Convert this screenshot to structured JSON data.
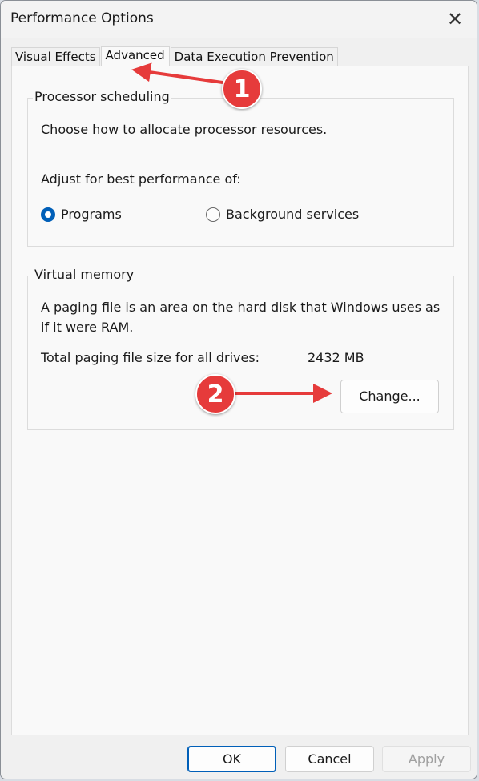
{
  "window": {
    "title": "Performance Options",
    "close_glyph": "✕"
  },
  "tabs": [
    {
      "label": "Visual Effects",
      "active": false
    },
    {
      "label": "Advanced",
      "active": true
    },
    {
      "label": "Data Execution Prevention",
      "active": false
    }
  ],
  "processor_scheduling": {
    "title": "Processor scheduling",
    "description": "Choose how to allocate processor resources.",
    "adjust_label": "Adjust for best performance of:",
    "options": [
      {
        "label": "Programs",
        "selected": true
      },
      {
        "label": "Background services",
        "selected": false
      }
    ]
  },
  "virtual_memory": {
    "title": "Virtual memory",
    "description_line1": "A paging file is an area on the hard disk that Windows uses as",
    "description_line2": "if it were RAM.",
    "total_label": "Total paging file size for all drives:",
    "total_value": "2432 MB",
    "change_button": "Change..."
  },
  "footer": {
    "ok": "OK",
    "cancel": "Cancel",
    "apply": "Apply"
  },
  "annotations": {
    "step1": "1",
    "step2": "2",
    "color": "#e63b3b"
  },
  "colors": {
    "accent": "#005fb8",
    "window_bg": "#f0f0f0",
    "panel_bg": "#f9f9f9"
  }
}
